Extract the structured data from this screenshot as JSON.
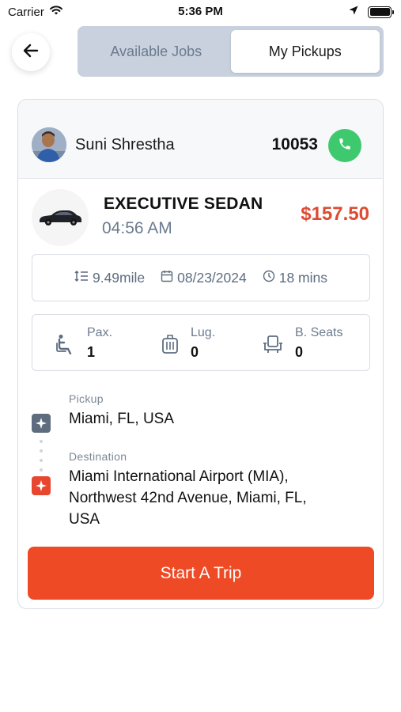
{
  "status_bar": {
    "carrier": "Carrier",
    "time": "5:36 PM"
  },
  "tabs": [
    {
      "label": "Available Jobs",
      "active": false
    },
    {
      "label": "My Pickups",
      "active": true
    }
  ],
  "booking": {
    "driver_name": "Suni Shrestha",
    "booking_number": "10053",
    "vehicle_type": "EXECUTIVE SEDAN",
    "pickup_time": "04:56 AM",
    "price": "$157.50",
    "distance": "9.49mile",
    "date": "08/23/2024",
    "duration": "18 mins",
    "passengers": {
      "label": "Pax.",
      "value": "1"
    },
    "luggage": {
      "label": "Lug.",
      "value": "0"
    },
    "booster_seats": {
      "label": "B. Seats",
      "value": "0"
    },
    "pickup": {
      "label": "Pickup",
      "value": "Miami, FL, USA"
    },
    "destination": {
      "label": "Destination",
      "line1": "Miami International Airport (MIA),",
      "line2": "Northwest 42nd Avenue, Miami, FL,",
      "line3": "USA"
    }
  },
  "actions": {
    "start_trip": "Start A Trip"
  },
  "colors": {
    "accent": "#ed4a25",
    "price": "#dd4b33",
    "call": "#3ec96f",
    "segment_bg": "#c8d1dd",
    "pickup_pin": "#5f6c80",
    "destination_pin": "#e7472f"
  },
  "icons": {
    "back": "arrow-left-icon",
    "call": "phone-icon",
    "distance": "route-distance-icon",
    "date": "calendar-icon",
    "duration": "clock-icon",
    "passengers": "seated-person-icon",
    "luggage": "suitcase-icon",
    "booster_seats": "car-seat-icon",
    "pickup_pin": "pickup-marker-icon",
    "destination_pin": "destination-marker-icon"
  }
}
